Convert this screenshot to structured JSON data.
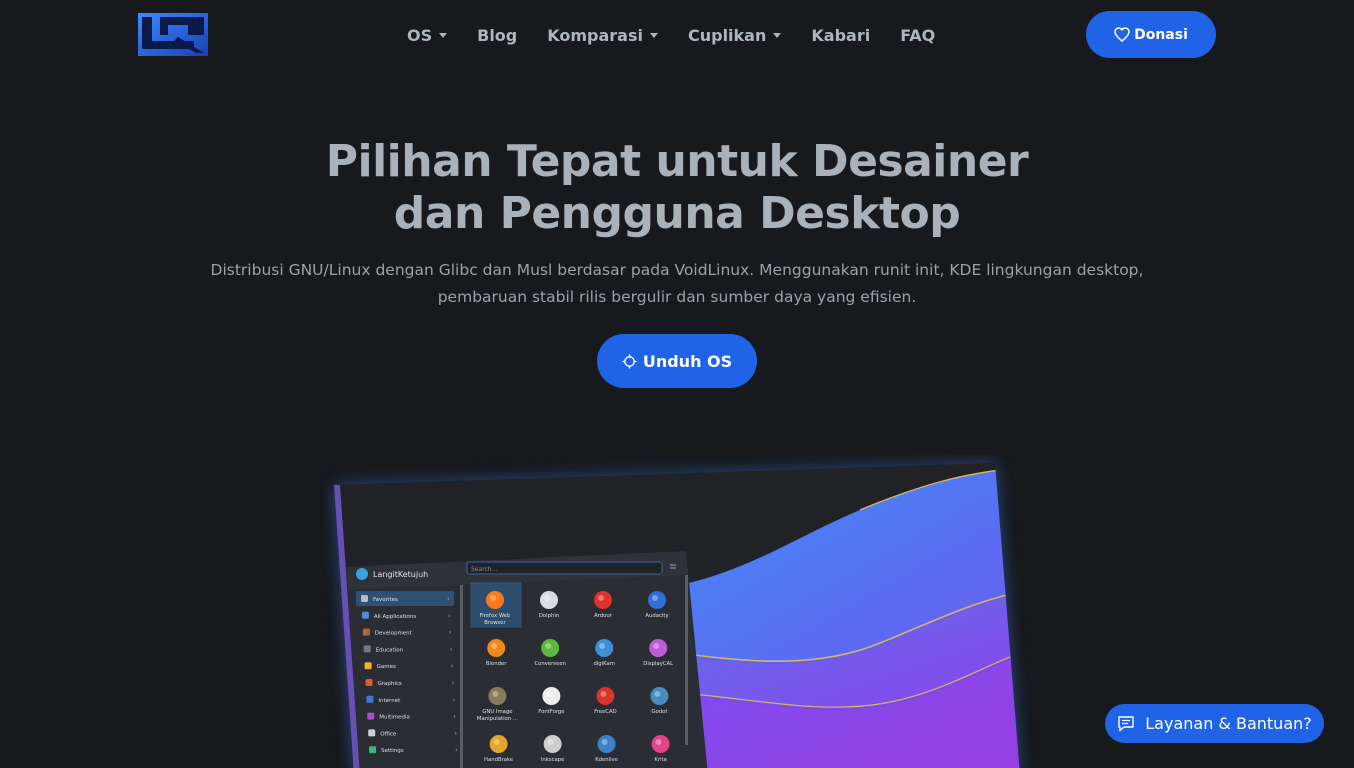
{
  "nav": {
    "items": [
      {
        "label": "OS",
        "dropdown": true
      },
      {
        "label": "Blog",
        "dropdown": false
      },
      {
        "label": "Komparasi",
        "dropdown": true
      },
      {
        "label": "Cuplikan",
        "dropdown": true
      },
      {
        "label": "Kabari",
        "dropdown": false
      },
      {
        "label": "FAQ",
        "dropdown": false
      }
    ],
    "donate": {
      "icon": "heart-icon",
      "label": "Donasi"
    }
  },
  "hero": {
    "title_line1": "Pilihan Tepat untuk Desainer",
    "title_line2": "dan Pengguna Desktop",
    "subtitle_line1": "Distribusi GNU/Linux dengan Glibc dan Musl berdasar pada VoidLinux. Menggunakan runit init, KDE lingkungan desktop,",
    "subtitle_line2": "pembaruan stabil rilis bergulir dan sumber daya yang efisien.",
    "download": {
      "icon": "crosshair-icon",
      "label": "Unduh OS"
    }
  },
  "desktop_preview": {
    "user_name": "LangitKetujuh",
    "search_placeholder": "Search...",
    "categories": [
      "Favorites",
      "All Applications",
      "Development",
      "Education",
      "Games",
      "Graphics",
      "Internet",
      "Multimedia",
      "Office",
      "Settings"
    ],
    "apps": [
      {
        "name": "Firefox Web Browser",
        "line1": "Firefox Web",
        "line2": "Browser",
        "color": "#ff7a1a"
      },
      {
        "name": "Dolphin",
        "line1": "Dolphin",
        "line2": "",
        "color": "#d9dde3"
      },
      {
        "name": "Ardour",
        "line1": "Ardour",
        "line2": "",
        "color": "#e0322d"
      },
      {
        "name": "Audacity",
        "line1": "Audacity",
        "line2": "",
        "color": "#2f6fd8"
      },
      {
        "name": "Blender",
        "line1": "Blender",
        "line2": "",
        "color": "#f0861c"
      },
      {
        "name": "Converseen",
        "line1": "Converseen",
        "line2": "",
        "color": "#5fb83e"
      },
      {
        "name": "digiKam",
        "line1": "digiKam",
        "line2": "",
        "color": "#3d8fd9"
      },
      {
        "name": "DisplayCAL",
        "line1": "DisplayCAL",
        "line2": "",
        "color": "#c05bd6"
      },
      {
        "name": "GNU Image Manipulation ...",
        "line1": "GNU Image",
        "line2": "Manipulation ...",
        "color": "#8a7a5c"
      },
      {
        "name": "FontForge",
        "line1": "FontForge",
        "line2": "",
        "color": "#eeeeee"
      },
      {
        "name": "FreeCAD",
        "line1": "FreeCAD",
        "line2": "",
        "color": "#d8342c"
      },
      {
        "name": "Godot",
        "line1": "Godot",
        "line2": "",
        "color": "#478cbf"
      },
      {
        "name": "HandBrake",
        "line1": "HandBrake",
        "line2": "",
        "color": "#e4a52a"
      },
      {
        "name": "Inkscape",
        "line1": "Inkscape",
        "line2": "",
        "color": "#cfcfcf"
      },
      {
        "name": "Kdenlive",
        "line1": "Kdenlive",
        "line2": "",
        "color": "#3e80c8"
      },
      {
        "name": "Krita",
        "line1": "Krita",
        "line2": "",
        "color": "#e3428a"
      }
    ]
  },
  "help": {
    "icon": "chat-icon",
    "label": "Layanan & Bantuan?"
  },
  "colors": {
    "accent": "#2063e6",
    "background": "#17191d",
    "text": "#adb5bd"
  }
}
